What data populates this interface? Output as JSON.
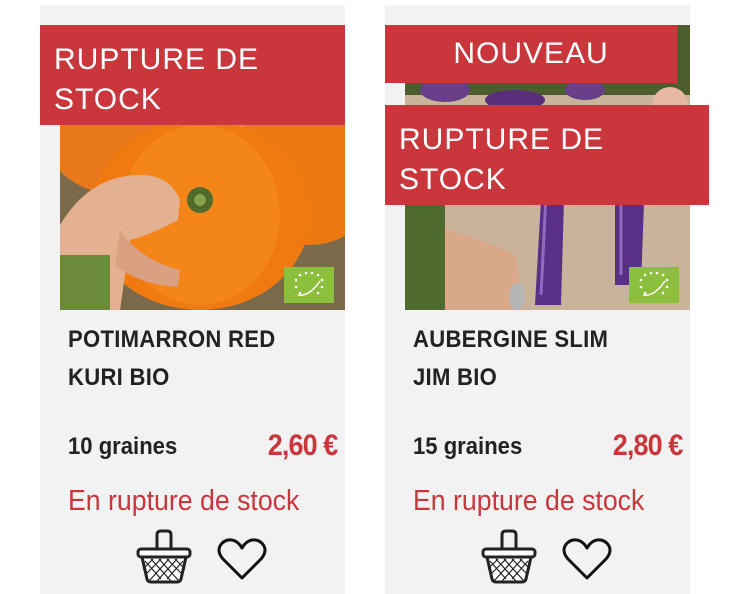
{
  "products": [
    {
      "banner_stock": "RUPTURE DE STOCK",
      "name": "POTIMARRON RED KURI BIO",
      "quantity": "10 graines",
      "price": "2,60 €",
      "availability": "En rupture de stock",
      "image": "pumpkin-photo",
      "badge": "eu-organic-logo"
    },
    {
      "banner_new": "NOUVEAU",
      "banner_stock": "RUPTURE DE STOCK",
      "name": "AUBERGINE SLIM JIM BIO",
      "quantity": "15 graines",
      "price": "2,80 €",
      "availability": "En rupture de stock",
      "image": "eggplant-photo",
      "badge": "eu-organic-logo"
    }
  ],
  "icons": {
    "basket": "basket-icon",
    "wishlist": "heart-icon"
  },
  "colors": {
    "accent": "#c9373d",
    "card_bg": "#f2f2f2",
    "text": "#222222",
    "organic_green": "#8dbf3f"
  }
}
